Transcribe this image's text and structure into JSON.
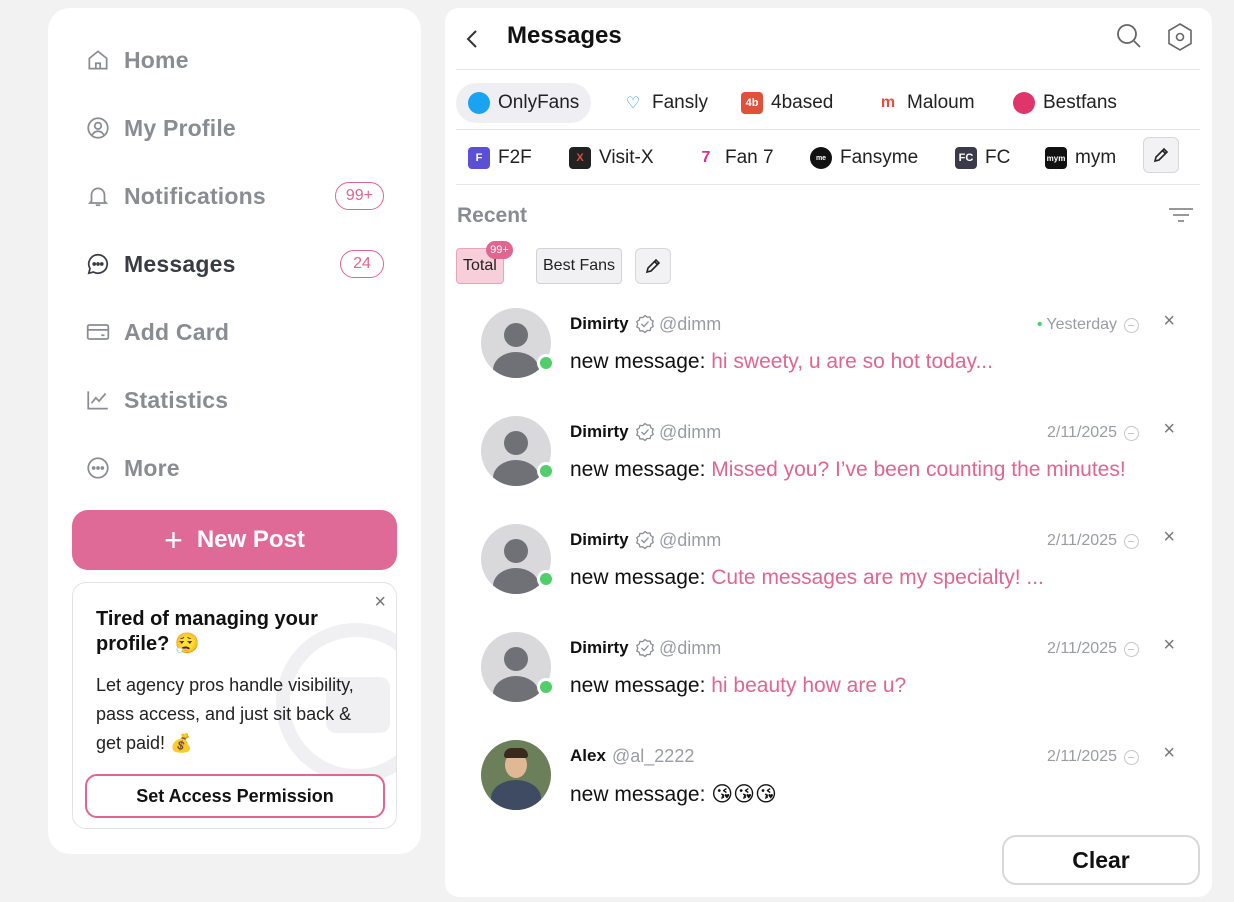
{
  "sidebar": {
    "items": [
      {
        "label": "Home",
        "icon": "home-icon"
      },
      {
        "label": "My Profile",
        "icon": "profile-icon"
      },
      {
        "label": "Notifications",
        "icon": "bell-icon",
        "badge": "99+"
      },
      {
        "label": "Messages",
        "icon": "chat-icon",
        "badge": "24",
        "active": true
      },
      {
        "label": "Add Card",
        "icon": "card-icon"
      },
      {
        "label": "Statistics",
        "icon": "chart-icon"
      },
      {
        "label": "More",
        "icon": "more-icon"
      }
    ],
    "new_post": "New Post",
    "promo": {
      "title": "Tired of managing your profile? 😮‍💨",
      "text": "Let agency pros handle visibility, pass access, and just sit back & get paid! 💰",
      "button": "Set Access Permission"
    }
  },
  "header": {
    "title": "Messages"
  },
  "platforms_row1": [
    "OnlyFans",
    "Fansly",
    "4based",
    "Maloum",
    "Bestfans"
  ],
  "platforms_row2": [
    "F2F",
    "Visit-X",
    "Fan 7",
    "Fansyme",
    "FC",
    "mym"
  ],
  "recent": {
    "title": "Recent",
    "chips": [
      {
        "label": "Total",
        "badge": "99+"
      },
      {
        "label": "Best Fans"
      }
    ]
  },
  "messages": [
    {
      "name": "Dimirty",
      "handle": "@dimm",
      "time": "Yesterday",
      "prefix": "new message:",
      "text": "hi sweety, u are so hot today..."
    },
    {
      "name": "Dimirty",
      "handle": "@dimm",
      "time": "2/11/2025",
      "prefix": "new message:",
      "text": "Missed you? I’ve been counting the minutes!"
    },
    {
      "name": "Dimirty",
      "handle": "@dimm",
      "time": "2/11/2025",
      "prefix": "new message:",
      "text": "Cute messages are my specialty! ..."
    },
    {
      "name": "Dimirty",
      "handle": "@dimm",
      "time": "2/11/2025",
      "prefix": "new message:",
      "text": "hi beauty how are u?"
    },
    {
      "name": "Alex",
      "handle": "@al_2222",
      "time": "2/11/2025",
      "prefix": "new message:",
      "text": "😘😘😘"
    }
  ],
  "clear_label": "Clear",
  "colors": {
    "accent": "#e06a97",
    "online": "#4fce6a",
    "muted": "#8a8c94"
  }
}
